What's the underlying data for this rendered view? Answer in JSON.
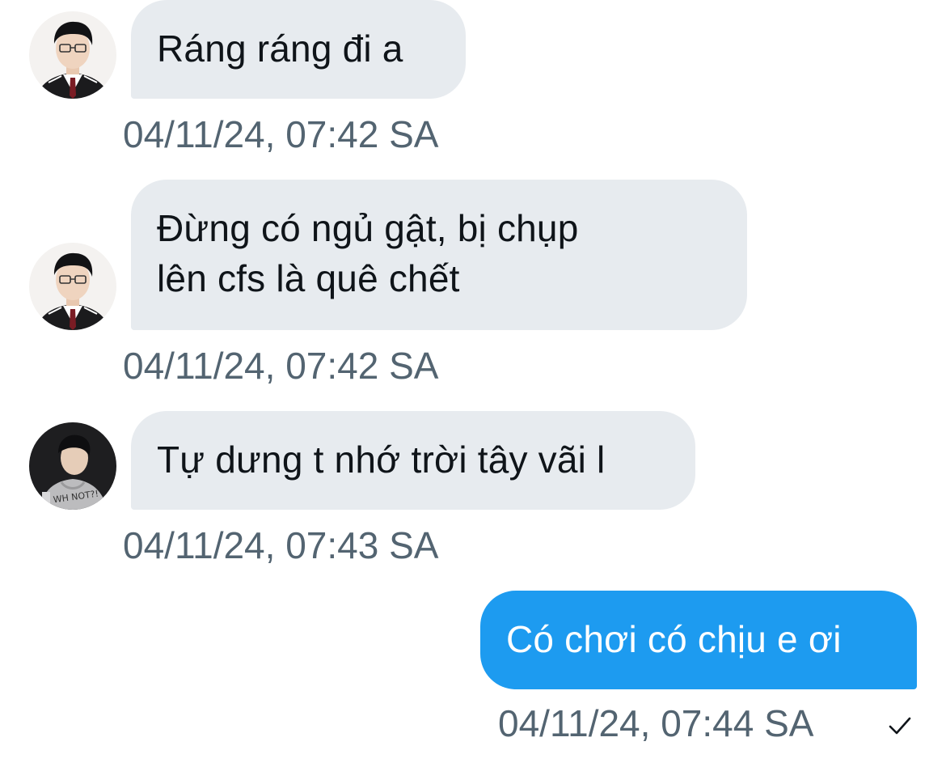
{
  "messages": [
    {
      "direction": "incoming",
      "avatar": "avatar-suit-boy",
      "lines": [
        "Ráng ráng đi a"
      ],
      "timestamp": "04/11/24, 07:42 SA"
    },
    {
      "direction": "incoming",
      "avatar": "avatar-suit-boy",
      "lines": [
        "Đừng có ngủ gật, bị chụp",
        "lên cfs là quê chết"
      ],
      "timestamp": "04/11/24, 07:42 SA"
    },
    {
      "direction": "incoming",
      "avatar": "avatar-hoodie-boy",
      "lines": [
        "Tự dưng t nhớ trời tây vãi l"
      ],
      "timestamp": "04/11/24, 07:43 SA"
    },
    {
      "direction": "outgoing",
      "lines": [
        "Có chơi có chịu e ơi"
      ],
      "timestamp": "04/11/24, 07:44 SA",
      "status_icon": "checkmark-icon"
    }
  ],
  "colors": {
    "incoming_bubble": "#e7ebef",
    "outgoing_bubble": "#1d9bf0",
    "incoming_text": "#0f1419",
    "outgoing_text": "#ffffff",
    "timestamp": "#536471"
  }
}
